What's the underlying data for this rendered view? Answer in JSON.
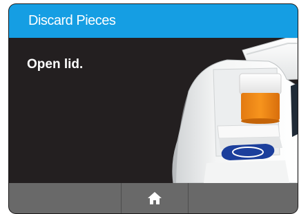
{
  "header": {
    "title": "Discard Pieces"
  },
  "main": {
    "instruction": "Open lid."
  },
  "footer": {
    "buttons": [
      {
        "name": "empty-left",
        "icon": ""
      },
      {
        "name": "home",
        "icon": "home-icon"
      },
      {
        "name": "empty-right",
        "icon": ""
      }
    ]
  },
  "colors": {
    "title_bar": "#159ee3",
    "content_background": "#231f20",
    "footer_background": "#696969",
    "accent_orange": "#f7901e",
    "accent_blue": "#1c3f9c"
  }
}
